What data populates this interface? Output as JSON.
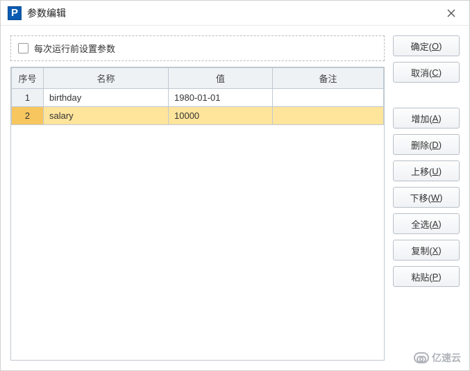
{
  "window": {
    "title": "参数编辑",
    "appIconLetter": "P"
  },
  "checkboxPanel": {
    "label": "每次运行前设置参数",
    "checked": false
  },
  "table": {
    "headers": {
      "seq": "序号",
      "name": "名称",
      "value": "值",
      "note": "备注"
    },
    "rows": [
      {
        "seq": "1",
        "name": "birthday",
        "value": "1980-01-01",
        "note": "",
        "selected": false
      },
      {
        "seq": "2",
        "name": "salary",
        "value": "10000",
        "note": "",
        "selected": true
      }
    ]
  },
  "buttons": {
    "ok": {
      "text": "确定",
      "hot": "O"
    },
    "cancel": {
      "text": "取消",
      "hot": "C"
    },
    "add": {
      "text": "增加",
      "hot": "A"
    },
    "delete": {
      "text": "删除",
      "hot": "D"
    },
    "up": {
      "text": "上移",
      "hot": "U"
    },
    "down": {
      "text": "下移",
      "hot": "W"
    },
    "all": {
      "text": "全选",
      "hot": "A"
    },
    "copy": {
      "text": "复制",
      "hot": "X"
    },
    "paste": {
      "text": "粘贴",
      "hot": "P"
    }
  },
  "watermark": {
    "text": "亿速云"
  }
}
